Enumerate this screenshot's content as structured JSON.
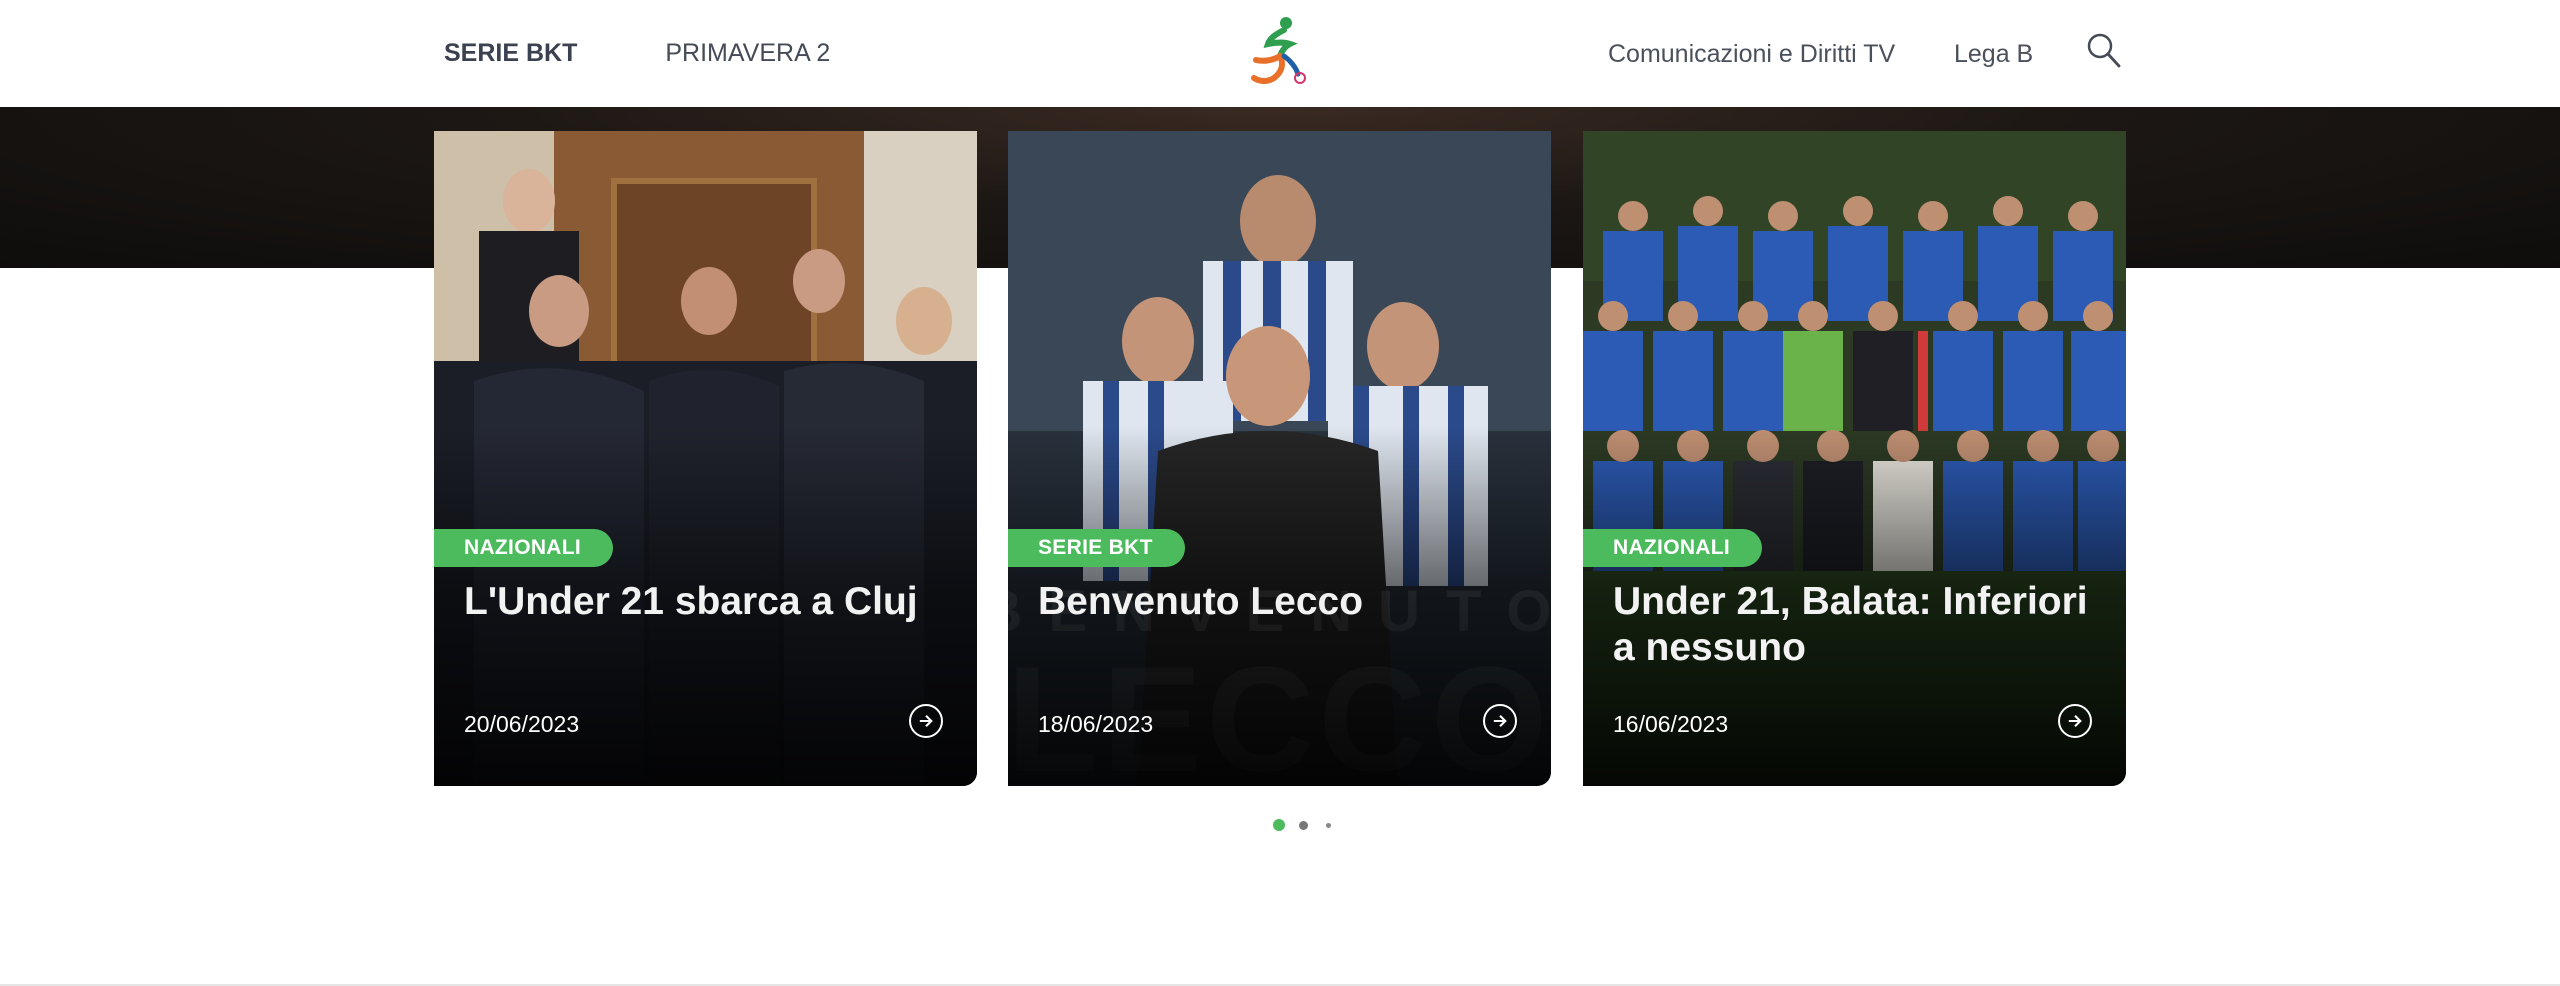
{
  "nav": {
    "left": [
      {
        "label": "SERIE BKT",
        "active": true
      },
      {
        "label": "PRIMAVERA 2",
        "active": false
      }
    ],
    "right": [
      {
        "label": "Comunicazioni e Diritti TV"
      },
      {
        "label": "Lega B"
      }
    ],
    "search_icon": "search-icon"
  },
  "colors": {
    "accent_green": "#4cbb5e",
    "logo_green": "#2f9e4f",
    "logo_orange": "#e8702a",
    "logo_blue": "#1f5fa8",
    "nav_text": "#444b57"
  },
  "cards": [
    {
      "category": "NAZIONALI",
      "title": "L'Under 21 sbarca a Cluj",
      "date": "20/06/2023",
      "arrow_icon": "arrow-right-circle-icon"
    },
    {
      "category": "SERIE BKT",
      "title": "Benvenuto Lecco",
      "date": "18/06/2023",
      "arrow_icon": "arrow-right-circle-icon",
      "overlay_text": [
        "BENVENUTO",
        "LECCO"
      ]
    },
    {
      "category": "NAZIONALI",
      "title": "Under 21, Balata: Inferiori a nessuno",
      "date": "16/06/2023",
      "arrow_icon": "arrow-right-circle-icon"
    }
  ],
  "pagination": {
    "pages": 3,
    "active": 1
  }
}
